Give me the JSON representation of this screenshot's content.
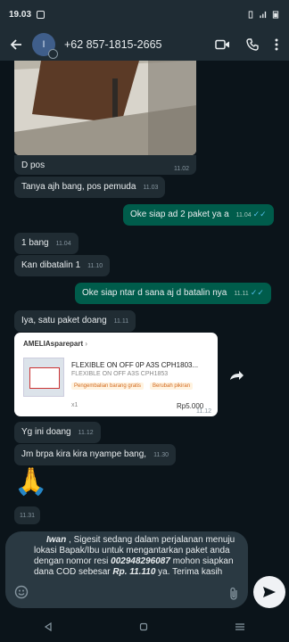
{
  "status": {
    "time": "19.03"
  },
  "header": {
    "avatar_letter": "I",
    "contact": "+62 857-1815-2665"
  },
  "messages": [
    {
      "text": "D pos",
      "time": "11.02"
    },
    {
      "text": "Tanya ajh bang, pos pemuda",
      "time": "11.03"
    },
    {
      "text": "Oke siap  ad 2 paket ya a",
      "time": "11.04"
    },
    {
      "text": "1 bang",
      "time": "11.04"
    },
    {
      "text": "Kan dibatalin 1",
      "time": "11.10"
    },
    {
      "text": "Oke siap ntar d sana aj d batalin nya",
      "time": "11.11"
    },
    {
      "text": "Iya, satu paket doang",
      "time": "11.11"
    },
    {
      "text": "Yg ini doang",
      "time": "11.12"
    },
    {
      "text": "Jm brpa kira kira nyampe bang,",
      "time": "11.30"
    },
    {
      "text": "🙏",
      "time": "11.31"
    }
  ],
  "product": {
    "shop": "AMELIAsparepart",
    "title": "FLEXIBLE ON OFF 0P A3S CPH1803...",
    "variant": "FLEXIBLE ON OFF A3S CPH1853",
    "tag1": "Pengembalian barang gratis",
    "tag2": "Berubah pikiran",
    "qty": "x1",
    "price": "Rp5.000",
    "time": "11.12"
  },
  "composer": {
    "name": "Iwan",
    "p1": " , Sigesit sedang dalam perjalanan menuju lokasi Bapak/Ibu untuk mengantarkan paket anda dengan nomor resi ",
    "resi": "002948296087",
    "p2": " mohon siapkan dana COD sebesar ",
    "amount": "Rp. 11.110",
    "p3": " ya. Terima kasih"
  },
  "colors": {
    "bg": "#0b141a",
    "incoming": "#202c33",
    "outgoing": "#005c4b",
    "bar": "#1f2c34",
    "tick": "#53bdeb"
  }
}
